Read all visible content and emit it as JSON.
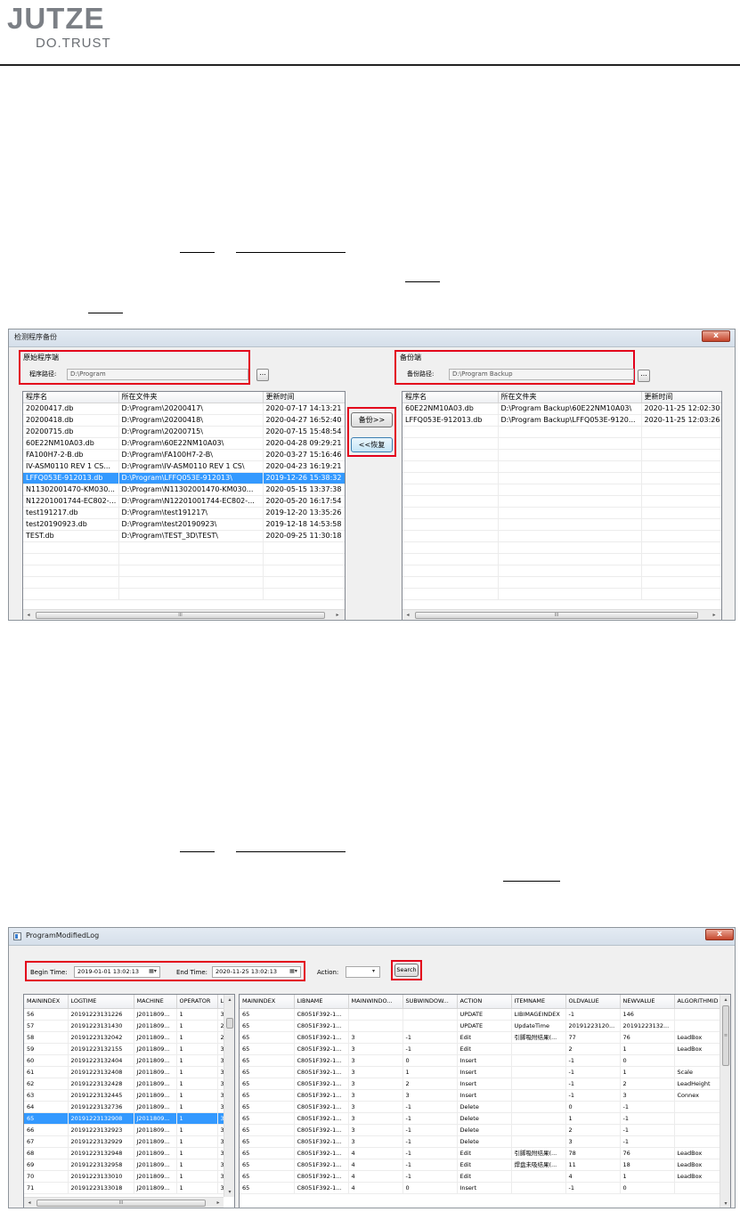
{
  "header": {
    "logo_main": "JUTZE",
    "logo_sub": "DO.TRUST"
  },
  "backup_window": {
    "title": "检测程序备份",
    "close_label": "x",
    "source_group_label": "原始程序端",
    "source_path_label": "程序路径:",
    "source_path_value": "D:\\Program",
    "browse_label": "...",
    "dest_group_label": "备份端",
    "dest_path_label": "备份路径:",
    "dest_path_value": "D:\\Program Backup",
    "backup_button": "备份>>",
    "restore_button": "<<恢复",
    "scroll_left": "◂",
    "scroll_right": "▸",
    "scroll_grip": "III",
    "left_columns": [
      "程序名",
      "所在文件夹",
      "更新时间"
    ],
    "left_rows": [
      [
        "20200417.db",
        "D:\\Program\\20200417\\",
        "2020-07-17 14:13:21"
      ],
      [
        "20200418.db",
        "D:\\Program\\20200418\\",
        "2020-04-27 16:52:40"
      ],
      [
        "20200715.db",
        "D:\\Program\\20200715\\",
        "2020-07-15 15:48:54"
      ],
      [
        "60E22NM10A03.db",
        "D:\\Program\\60E22NM10A03\\",
        "2020-04-28 09:29:21"
      ],
      [
        "FA100H7-2-B.db",
        "D:\\Program\\FA100H7-2-B\\",
        "2020-03-27 15:16:46"
      ],
      [
        "IV-ASM0110 REV 1 CS...",
        "D:\\Program\\IV-ASM0110 REV 1 CS\\",
        "2020-04-23 16:19:21"
      ],
      [
        "LFFQ053E-912013.db",
        "D:\\Program\\LFFQ053E-912013\\",
        "2019-12-26 15:38:32"
      ],
      [
        "N11302001470-KM030...",
        "D:\\Program\\N11302001470-KM030...",
        "2020-05-15 13:37:38"
      ],
      [
        "N12201001744-EC802-...",
        "D:\\Program\\N12201001744-EC802-...",
        "2020-05-20 16:17:54"
      ],
      [
        "test191217.db",
        "D:\\Program\\test191217\\",
        "2019-12-20 13:35:26"
      ],
      [
        "test20190923.db",
        "D:\\Program\\test20190923\\",
        "2019-12-18 14:53:58"
      ],
      [
        "TEST.db",
        "D:\\Program\\TEST_3D\\TEST\\",
        "2020-09-25 11:30:18"
      ]
    ],
    "left_selected_index": 6,
    "right_columns": [
      "程序名",
      "所在文件夹",
      "更新时间"
    ],
    "right_rows": [
      [
        "60E22NM10A03.db",
        "D:\\Program Backup\\60E22NM10A03\\",
        "2020-11-25 12:02:30"
      ],
      [
        "LFFQ053E-912013.db",
        "D:\\Program Backup\\LFFQ053E-9120...",
        "2020-11-25 12:03:26"
      ]
    ]
  },
  "log_window": {
    "title": "ProgramModifiedLog",
    "close_label": "x",
    "begin_label": "Begin Time:",
    "begin_value": "2019-01-01 13:02:13",
    "end_label": "End Time:",
    "end_value": "2020-11-25 13:02:13",
    "action_label": "Action:",
    "action_value": "",
    "dropdown_glyph": "▦▾",
    "combo_arrow": "▾",
    "search_button": "Search",
    "scroll_up": "▴",
    "scroll_down": "▾",
    "scroll_left": "◂",
    "scroll_right": "▸",
    "scroll_grip": "III",
    "scroll_vgrip": "≡",
    "left_columns": [
      "MAININDEX",
      "LOGTIME",
      "MACHINE",
      "OPERATOR",
      "L"
    ],
    "left_rows": [
      [
        "56",
        "20191223131226",
        "J2011809...",
        "1",
        "3"
      ],
      [
        "57",
        "20191223131430",
        "J2011809...",
        "1",
        "2"
      ],
      [
        "58",
        "20191223132042",
        "J2011809...",
        "1",
        "2"
      ],
      [
        "59",
        "20191223132155",
        "J2011809...",
        "1",
        "3"
      ],
      [
        "60",
        "20191223132404",
        "J2011809...",
        "1",
        "3"
      ],
      [
        "61",
        "20191223132408",
        "J2011809...",
        "1",
        "3"
      ],
      [
        "62",
        "20191223132428",
        "J2011809...",
        "1",
        "3"
      ],
      [
        "63",
        "20191223132445",
        "J2011809...",
        "1",
        "3"
      ],
      [
        "64",
        "20191223132736",
        "J2011809...",
        "1",
        "3"
      ],
      [
        "65",
        "20191223132908",
        "J2011809...",
        "1",
        "3"
      ],
      [
        "66",
        "20191223132923",
        "J2011809...",
        "1",
        "3"
      ],
      [
        "67",
        "20191223132929",
        "J2011809...",
        "1",
        "3"
      ],
      [
        "68",
        "20191223132948",
        "J2011809...",
        "1",
        "3"
      ],
      [
        "69",
        "20191223132958",
        "J2011809...",
        "1",
        "3"
      ],
      [
        "70",
        "20191223133010",
        "J2011809...",
        "1",
        "3"
      ],
      [
        "71",
        "20191223133018",
        "J2011809...",
        "1",
        "3"
      ]
    ],
    "left_selected_index": 9,
    "right_columns": [
      "MAININDEX",
      "LIBNAME",
      "MAINWINDO...",
      "SUBWINDOW...",
      "ACTION",
      "ITEMNAME",
      "OLDVALUE",
      "NEWVALUE",
      "ALGORITHMID"
    ],
    "right_rows": [
      [
        "65",
        "C8051F392-1...",
        "",
        "",
        "UPDATE",
        "LIBIMAGEINDEX",
        "-1",
        "146",
        ""
      ],
      [
        "65",
        "C8051F392-1...",
        "",
        "",
        "UPDATE",
        "UpdateTime",
        "20191223120...",
        "20191223132...",
        ""
      ],
      [
        "65",
        "C8051F392-1...",
        "3",
        "-1",
        "Edit",
        "引脚吸附结果(...",
        "77",
        "76",
        "LeadBox"
      ],
      [
        "65",
        "C8051F392-1...",
        "3",
        "-1",
        "Edit",
        "",
        "2",
        "1",
        "LeadBox"
      ],
      [
        "65",
        "C8051F392-1...",
        "3",
        "0",
        "Insert",
        "",
        "-1",
        "0",
        ""
      ],
      [
        "65",
        "C8051F392-1...",
        "3",
        "1",
        "Insert",
        "",
        "-1",
        "1",
        "Scale"
      ],
      [
        "65",
        "C8051F392-1...",
        "3",
        "2",
        "Insert",
        "",
        "-1",
        "2",
        "LeadHeight"
      ],
      [
        "65",
        "C8051F392-1...",
        "3",
        "3",
        "Insert",
        "",
        "-1",
        "3",
        "Connex"
      ],
      [
        "65",
        "C8051F392-1...",
        "3",
        "-1",
        "Delete",
        "",
        "0",
        "-1",
        ""
      ],
      [
        "65",
        "C8051F392-1...",
        "3",
        "-1",
        "Delete",
        "",
        "1",
        "-1",
        ""
      ],
      [
        "65",
        "C8051F392-1...",
        "3",
        "-1",
        "Delete",
        "",
        "2",
        "-1",
        ""
      ],
      [
        "65",
        "C8051F392-1...",
        "3",
        "-1",
        "Delete",
        "",
        "3",
        "-1",
        ""
      ],
      [
        "65",
        "C8051F392-1...",
        "4",
        "-1",
        "Edit",
        "引脚吸附结果(...",
        "78",
        "76",
        "LeadBox"
      ],
      [
        "65",
        "C8051F392-1...",
        "4",
        "-1",
        "Edit",
        "焊盘未吸结果(...",
        "11",
        "18",
        "LeadBox"
      ],
      [
        "65",
        "C8051F392-1...",
        "4",
        "-1",
        "Edit",
        "",
        "4",
        "1",
        "LeadBox"
      ],
      [
        "65",
        "C8051F392-1...",
        "4",
        "0",
        "Insert",
        "",
        "-1",
        "0",
        ""
      ]
    ]
  }
}
